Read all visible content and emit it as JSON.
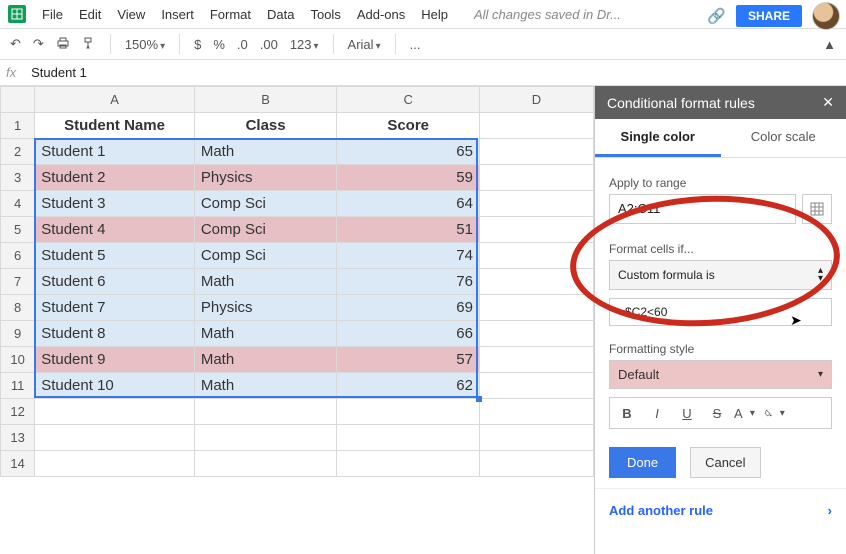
{
  "menu": {
    "items": [
      "File",
      "Edit",
      "View",
      "Insert",
      "Format",
      "Data",
      "Tools",
      "Add-ons",
      "Help"
    ],
    "saved": "All changes saved in Dr...",
    "share": "SHARE"
  },
  "toolbar": {
    "zoom": "150%",
    "currency": "$",
    "percent": "%",
    "dec_dec": ".0",
    "dec_inc": ".00",
    "numfmt": "123",
    "font": "Arial",
    "more": "..."
  },
  "fx": {
    "label": "fx",
    "value": "Student 1"
  },
  "grid": {
    "columns": [
      "A",
      "B",
      "C",
      "D"
    ],
    "headers": {
      "A": "Student Name",
      "B": "Class",
      "C": "Score"
    },
    "rows": [
      {
        "n": 1,
        "a": "Student Name",
        "b": "Class",
        "c": "Score",
        "header": true
      },
      {
        "n": 2,
        "a": "Student 1",
        "b": "Math",
        "c": 65,
        "hl": false
      },
      {
        "n": 3,
        "a": "Student 2",
        "b": "Physics",
        "c": 59,
        "hl": true
      },
      {
        "n": 4,
        "a": "Student 3",
        "b": "Comp Sci",
        "c": 64,
        "hl": false
      },
      {
        "n": 5,
        "a": "Student 4",
        "b": "Comp Sci",
        "c": 51,
        "hl": true
      },
      {
        "n": 6,
        "a": "Student 5",
        "b": "Comp Sci",
        "c": 74,
        "hl": false
      },
      {
        "n": 7,
        "a": "Student 6",
        "b": "Math",
        "c": 76,
        "hl": false
      },
      {
        "n": 8,
        "a": "Student 7",
        "b": "Physics",
        "c": 69,
        "hl": false
      },
      {
        "n": 9,
        "a": "Student 8",
        "b": "Math",
        "c": 66,
        "hl": false
      },
      {
        "n": 10,
        "a": "Student 9",
        "b": "Math",
        "c": 57,
        "hl": true
      },
      {
        "n": 11,
        "a": "Student 10",
        "b": "Math",
        "c": 62,
        "hl": false
      },
      {
        "n": 12,
        "a": "",
        "b": "",
        "c": "",
        "empty": true
      },
      {
        "n": 13,
        "a": "",
        "b": "",
        "c": "",
        "empty": true
      },
      {
        "n": 14,
        "a": "",
        "b": "",
        "c": "",
        "empty": true
      }
    ]
  },
  "panel": {
    "title": "Conditional format rules",
    "tab1": "Single color",
    "tab2": "Color scale",
    "apply_label": "Apply to range",
    "range": "A2:C11",
    "condition_label": "Format cells if...",
    "condition": "Custom formula is",
    "formula": "=$C2<60",
    "style_label": "Formatting style",
    "style": "Default",
    "done": "Done",
    "cancel": "Cancel",
    "add": "Add another rule"
  }
}
